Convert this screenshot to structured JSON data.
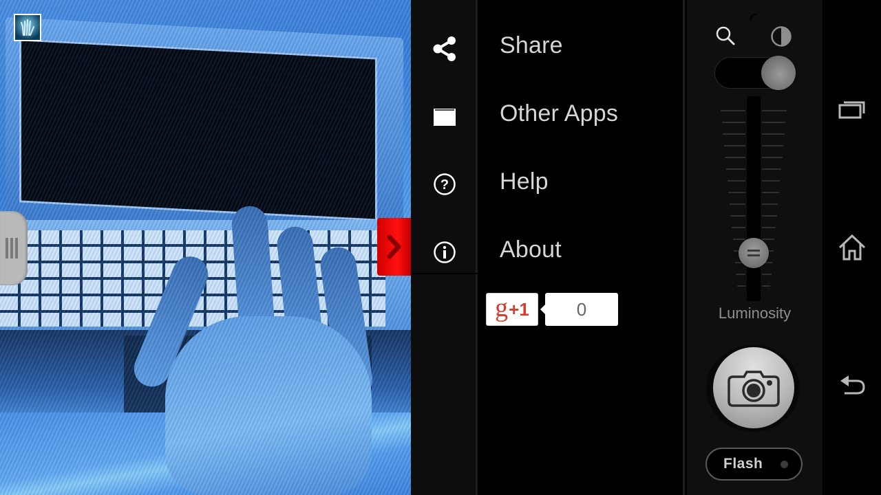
{
  "preview": {
    "description": "camera preview - hand over laptop keyboard, blue color filter",
    "app_logo_icon": "hand-logo-icon",
    "left_drawer_icon": "drawer-grip-icon",
    "right_drawer_icon": "chevron-right-icon"
  },
  "rail": {
    "items": [
      {
        "icon": "share-icon"
      },
      {
        "icon": "folder-icon"
      },
      {
        "icon": "help-circle-icon"
      },
      {
        "icon": "info-circle-icon"
      }
    ]
  },
  "menu": {
    "items": [
      {
        "label": "Share"
      },
      {
        "label": "Other Apps"
      },
      {
        "label": "Help"
      },
      {
        "label": "About"
      }
    ],
    "gplus": {
      "g": "g",
      "plus": "+1",
      "count": "0"
    }
  },
  "controls": {
    "zoom_icon": "magnifier-icon",
    "contrast_icon": "contrast-icon",
    "toggle_on": true,
    "luminosity_label": "Luminosity",
    "luminosity_level_fraction": 0.22,
    "shutter_icon": "camera-icon",
    "flash_label": "Flash",
    "flash_on": false
  },
  "navbar": {
    "recent_icon": "recent-apps-icon",
    "home_icon": "home-icon",
    "back_icon": "back-icon"
  },
  "colors": {
    "preview_tint": "#4a8fe0",
    "drawer_red": "#e00000",
    "gplus_red": "#d23f31",
    "menu_text": "#d6d6d6"
  }
}
